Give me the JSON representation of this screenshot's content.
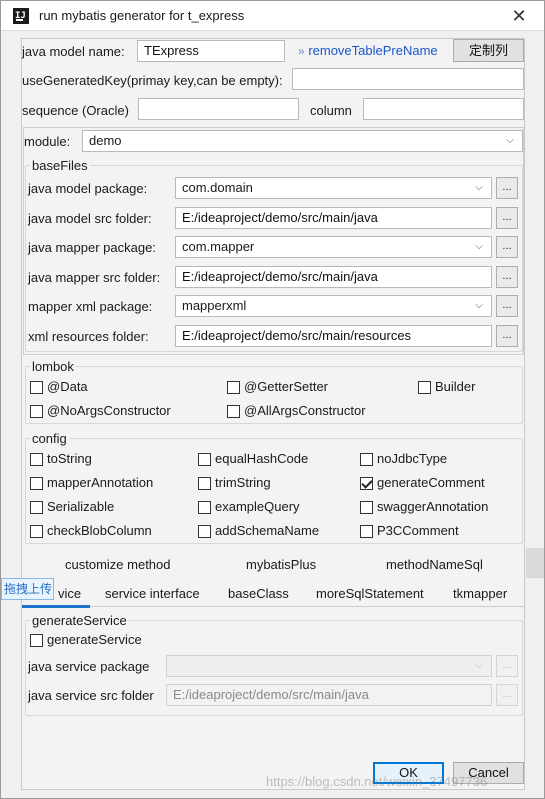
{
  "window": {
    "title": "run mybatis generator for t_express"
  },
  "top": {
    "java_model_name_label": "java model name:",
    "java_model_name_value": "TExpress",
    "remove_prefix_chevron": "»",
    "remove_prefix_link": "removeTablePreName",
    "custom_columns_button": "定制列",
    "use_generated_key_label": "useGeneratedKey(primay key,can be empty):",
    "use_generated_key_value": "",
    "sequence_label": "sequence (Oracle)",
    "sequence_value": "",
    "column_label": "column",
    "column_value": ""
  },
  "module": {
    "label": "module:",
    "value": "demo"
  },
  "basefiles": {
    "title": "baseFiles",
    "rows": [
      {
        "label": "java model package:",
        "value": "com.domain",
        "dropdown": true,
        "browse": "..."
      },
      {
        "label": "java model src folder:",
        "value": "E:/ideaproject/demo/src/main/java",
        "dropdown": false,
        "browse": "..."
      },
      {
        "label": "java mapper package:",
        "value": "com.mapper",
        "dropdown": true,
        "browse": "..."
      },
      {
        "label": "java mapper src folder:",
        "value": "E:/ideaproject/demo/src/main/java",
        "dropdown": false,
        "browse": "..."
      },
      {
        "label": "mapper xml package:",
        "value": "mapperxml",
        "dropdown": true,
        "browse": "..."
      },
      {
        "label": "xml resources folder:",
        "value": "E:/ideaproject/demo/src/main/resources",
        "dropdown": false,
        "browse": "..."
      }
    ]
  },
  "lombok": {
    "title": "lombok",
    "items": [
      {
        "label": "@Data",
        "checked": false
      },
      {
        "label": "@GetterSetter",
        "checked": false
      },
      {
        "label": "Builder",
        "checked": false
      },
      {
        "label": "@NoArgsConstructor",
        "checked": false
      },
      {
        "label": "@AllArgsConstructor",
        "checked": false
      }
    ]
  },
  "config": {
    "title": "config",
    "items": [
      {
        "label": "toString",
        "checked": false
      },
      {
        "label": "equalHashCode",
        "checked": false
      },
      {
        "label": "noJdbcType",
        "checked": false
      },
      {
        "label": "mapperAnnotation",
        "checked": false
      },
      {
        "label": "trimString",
        "checked": false
      },
      {
        "label": "generateComment",
        "checked": true
      },
      {
        "label": "Serializable",
        "checked": false
      },
      {
        "label": "exampleQuery",
        "checked": false
      },
      {
        "label": "swaggerAnnotation",
        "checked": false
      },
      {
        "label": "checkBlobColumn",
        "checked": false
      },
      {
        "label": "addSchemaName",
        "checked": false
      },
      {
        "label": "P3CComment",
        "checked": false
      }
    ]
  },
  "tabs_row1": [
    "customize method",
    "mybatisPlus",
    "methodNameSql"
  ],
  "tabs_row2": [
    "vice",
    "service interface",
    "baseClass",
    "moreSqlStatement",
    "tkmapper"
  ],
  "overlay_tooltip": "拖拽上传",
  "service": {
    "title": "generateService",
    "checkbox_label": "generateService",
    "checked": false,
    "package_label": "java service package",
    "package_value": "",
    "folder_label": "java service src folder",
    "folder_value": "E:/ideaproject/demo/src/main/java",
    "browse": "..."
  },
  "buttons": {
    "ok": "OK",
    "cancel": "Cancel"
  },
  "watermark": "https://blog.csdn.net/weixin_37497736",
  "colors": {
    "link": "#1a57c8",
    "accent": "#0078d7",
    "tab_underline": "#1a73c9"
  }
}
